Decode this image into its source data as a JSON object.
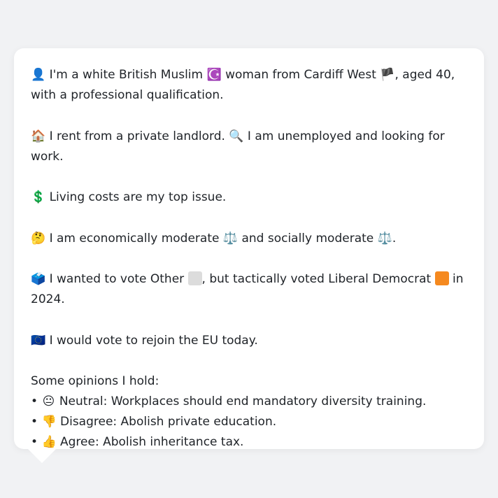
{
  "bio": {
    "icon": "person-icon",
    "text_a": " I'm a white British Muslim ",
    "religion_icon": "star-crescent-icon",
    "text_b": " woman from Cardiff West ",
    "place_icon": "wales-flag-icon",
    "text_c": ", aged 40, with a professional qualification.",
    "person_glyph": "👤",
    "religion_glyph": "☪️",
    "flag_glyph": "🏴"
  },
  "housing": {
    "house_glyph": "🏠",
    "housing_text": " I rent from a private landlord. ",
    "search_glyph": "🔍",
    "work_text": " I am unemployed and looking for work."
  },
  "issue": {
    "dollar_glyph": "💲",
    "text": " Living costs are my top issue."
  },
  "ideology": {
    "think_glyph": "🤔",
    "text_a": " I am economically moderate ",
    "scale_glyph": "⚖️",
    "text_b": " and socially moderate ",
    "scale_glyph_2": "⚖️",
    "text_c": "."
  },
  "vote": {
    "ballot_glyph": "🗳️",
    "text_a": " I wanted to vote Other ",
    "other_color": "#dcdcdc",
    "text_b": ", but tactically voted Liberal Democrat ",
    "libdem_color": "#f5891f",
    "text_c": " in 2024."
  },
  "eu": {
    "eu_glyph": "🇪🇺",
    "text": " I would vote to rejoin the EU today."
  },
  "opinions": {
    "heading": "Some opinions I hold:",
    "items": [
      {
        "bullet": "•",
        "glyph": "😐",
        "text": " Neutral: Workplaces should end mandatory diversity training."
      },
      {
        "bullet": "•",
        "glyph": "👎",
        "text": " Disagree: Abolish private education."
      },
      {
        "bullet": "•",
        "glyph": "👍",
        "text": " Agree: Abolish inheritance tax."
      }
    ]
  }
}
